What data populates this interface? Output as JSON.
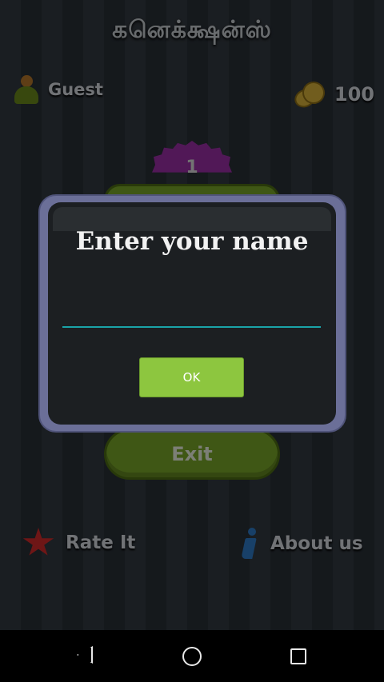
{
  "app": {
    "title": "கனெக்க்ஷன்ஸ்"
  },
  "user": {
    "name": "Guest",
    "coins": "100"
  },
  "level": {
    "number": "1"
  },
  "menu": {
    "exit_label": "Exit",
    "rate_label": "Rate It",
    "about_label": "About us"
  },
  "dialog": {
    "title": "Enter your name",
    "input_value": "",
    "input_placeholder": "",
    "ok_label": "OK"
  },
  "colors": {
    "accent_green": "#8dc63f",
    "input_underline": "#1aa3a8",
    "dialog_frame": "#6b6f98"
  },
  "icons": {
    "user": "user-icon",
    "coins": "coins-icon",
    "star": "star-icon",
    "info": "info-icon"
  }
}
